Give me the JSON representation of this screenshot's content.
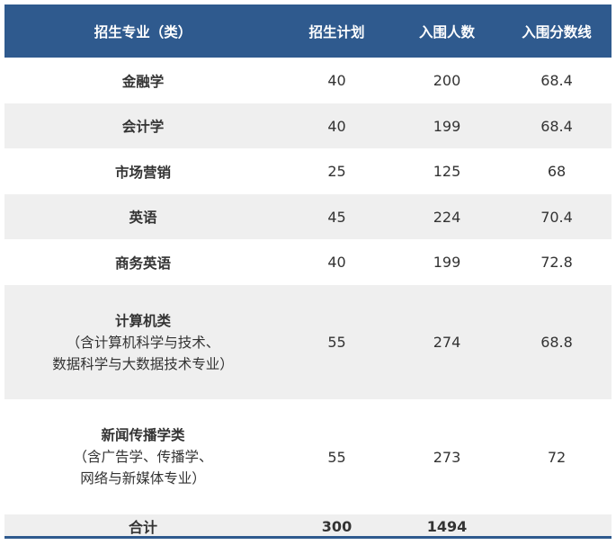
{
  "headers": [
    "招生专业（类）",
    "招生计划",
    "入围人数",
    "入围分数线"
  ],
  "rows": [
    {
      "name": "金融学",
      "plan": "40",
      "admitted": "200",
      "cutoff": "68.4"
    },
    {
      "name": "会计学",
      "plan": "40",
      "admitted": "199",
      "cutoff": "68.4"
    },
    {
      "name": "市场营销",
      "plan": "25",
      "admitted": "125",
      "cutoff": "68"
    },
    {
      "name": "英语",
      "plan": "45",
      "admitted": "224",
      "cutoff": "70.4"
    },
    {
      "name": "商务英语",
      "plan": "40",
      "admitted": "199",
      "cutoff": "72.8"
    },
    {
      "name": "计算机类",
      "sub1": "（含计算机科学与技术、",
      "sub2": "数据科学与大数据技术专业）",
      "plan": "55",
      "admitted": "274",
      "cutoff": "68.8"
    },
    {
      "name": "新闻传播学类",
      "sub1": "（含广告学、传播学、",
      "sub2": "网络与新媒体专业）",
      "plan": "55",
      "admitted": "273",
      "cutoff": "72"
    }
  ],
  "total": {
    "label": "合计",
    "plan": "300",
    "admitted": "1494",
    "cutoff": ""
  },
  "colors": {
    "header_bg": "#2f5a8e",
    "stripe": "#efefef",
    "text": "#333333"
  }
}
